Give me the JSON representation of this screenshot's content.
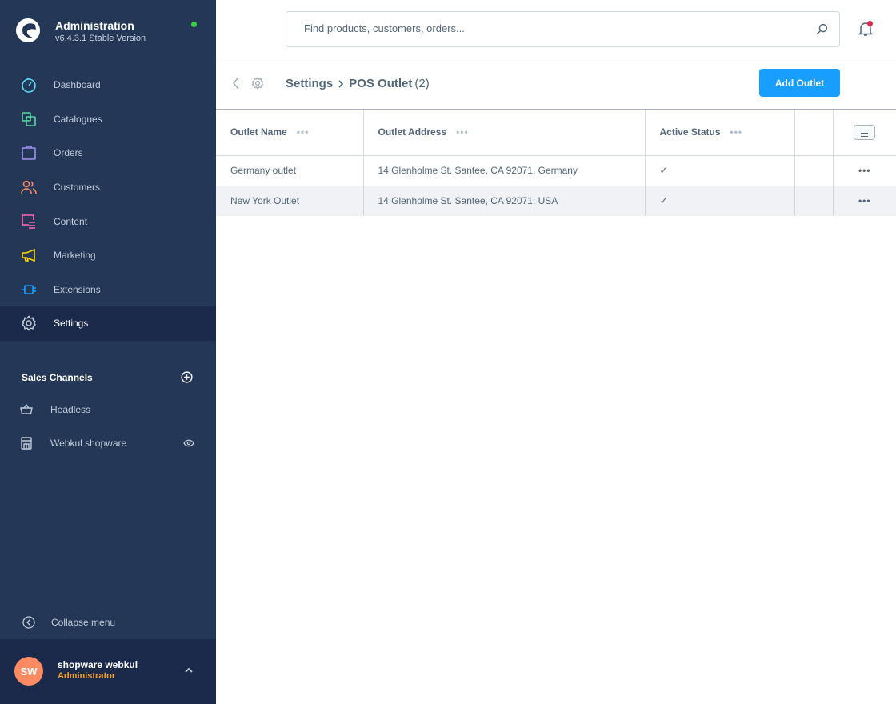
{
  "app": {
    "title": "Administration",
    "version": "v6.4.3.1 Stable Version",
    "status_color": "#37d046"
  },
  "sidebar": {
    "items": [
      {
        "label": "Dashboard",
        "icon": "dashboard-icon",
        "color": "#57d9f3"
      },
      {
        "label": "Catalogues",
        "icon": "catalogues-icon",
        "color": "#57d9a3"
      },
      {
        "label": "Orders",
        "icon": "orders-icon",
        "color": "#a092f0"
      },
      {
        "label": "Customers",
        "icon": "customers-icon",
        "color": "#f88962"
      },
      {
        "label": "Content",
        "icon": "content-icon",
        "color": "#ff68b4"
      },
      {
        "label": "Marketing",
        "icon": "marketing-icon",
        "color": "#ffd700"
      },
      {
        "label": "Extensions",
        "icon": "extensions-icon",
        "color": "#189eff"
      },
      {
        "label": "Settings",
        "icon": "settings-icon",
        "color": "#c1cbd8",
        "active": true
      }
    ],
    "sales_channels": {
      "title": "Sales Channels",
      "items": [
        {
          "label": "Headless"
        },
        {
          "label": "Webkul shopware"
        }
      ]
    },
    "collapse_label": "Collapse menu",
    "user": {
      "initials": "SW",
      "name": "shopware webkul",
      "role": "Administrator"
    }
  },
  "header": {
    "search_placeholder": "Find products, customers, orders...",
    "notification_dot": "#de294c"
  },
  "smartbar": {
    "breadcrumb_parent": "Settings",
    "title": "POS Outlet",
    "count": "(2)",
    "add_button": "Add Outlet"
  },
  "table": {
    "columns": [
      "Outlet Name",
      "Outlet Address",
      "Active Status"
    ],
    "rows": [
      {
        "name": "Germany outlet",
        "address": "14 Glenholme St. Santee, CA 92071, Germany",
        "active": "✓"
      },
      {
        "name": "New York Outlet",
        "address": "14 Glenholme St. Santee, CA 92071, USA",
        "active": "✓"
      }
    ],
    "row_actions": "•••",
    "header_dots": "•••"
  }
}
